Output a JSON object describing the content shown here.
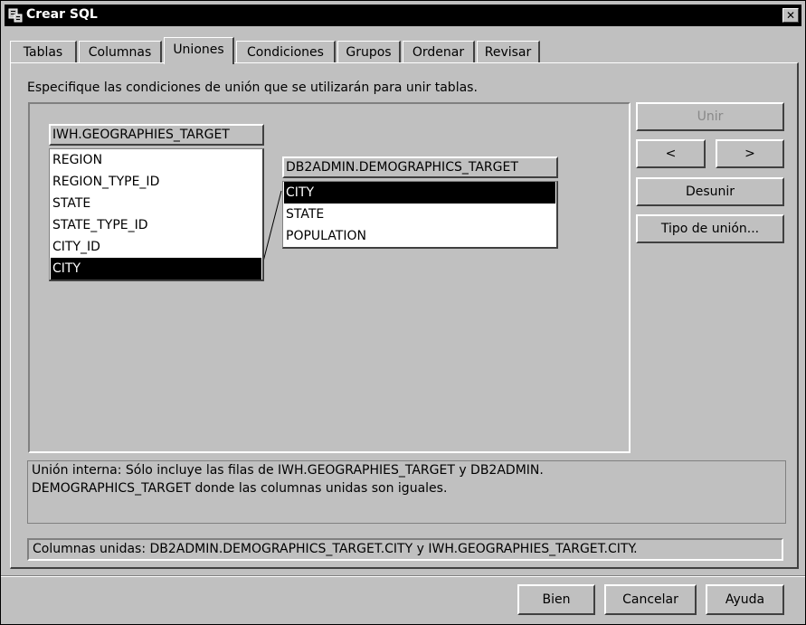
{
  "window": {
    "title": "Crear SQL",
    "close_glyph": "✕"
  },
  "tabs": [
    {
      "label": "Tablas",
      "active": false
    },
    {
      "label": "Columnas",
      "active": false
    },
    {
      "label": "Uniones",
      "active": true
    },
    {
      "label": "Condiciones",
      "active": false
    },
    {
      "label": "Grupos",
      "active": false
    },
    {
      "label": "Ordenar",
      "active": false
    },
    {
      "label": "Revisar",
      "active": false
    }
  ],
  "instructions": "Especifique las condiciones de unión que se utilizarán para unir tablas.",
  "tables": [
    {
      "name": "IWH.GEOGRAPHIES_TARGET",
      "columns": [
        "REGION",
        "REGION_TYPE_ID",
        "STATE",
        "STATE_TYPE_ID",
        "CITY_ID",
        "CITY"
      ],
      "selected": "CITY"
    },
    {
      "name": "DB2ADMIN.DEMOGRAPHICS_TARGET",
      "columns": [
        "CITY",
        "STATE",
        "POPULATION"
      ],
      "selected": "CITY"
    }
  ],
  "side_buttons": {
    "join": "Unir",
    "prev": "<",
    "next": ">",
    "unjoin": "Desunir",
    "join_type": "Tipo de unión..."
  },
  "info": {
    "line1": "Unión interna: Sólo incluye las filas de IWH.GEOGRAPHIES_TARGET y DB2ADMIN.",
    "line2": "DEMOGRAPHICS_TARGET donde las columnas unidas son iguales."
  },
  "joined_columns": "Columnas unidas: DB2ADMIN.DEMOGRAPHICS_TARGET.CITY y IWH.GEOGRAPHIES_TARGET.CITY.",
  "footer": {
    "ok": "Bien",
    "cancel": "Cancelar",
    "help": "Ayuda"
  },
  "colors": {
    "face": "#c0c0c0",
    "highlight": "#ffffff",
    "shadow": "#404040",
    "selection": "#000000"
  }
}
